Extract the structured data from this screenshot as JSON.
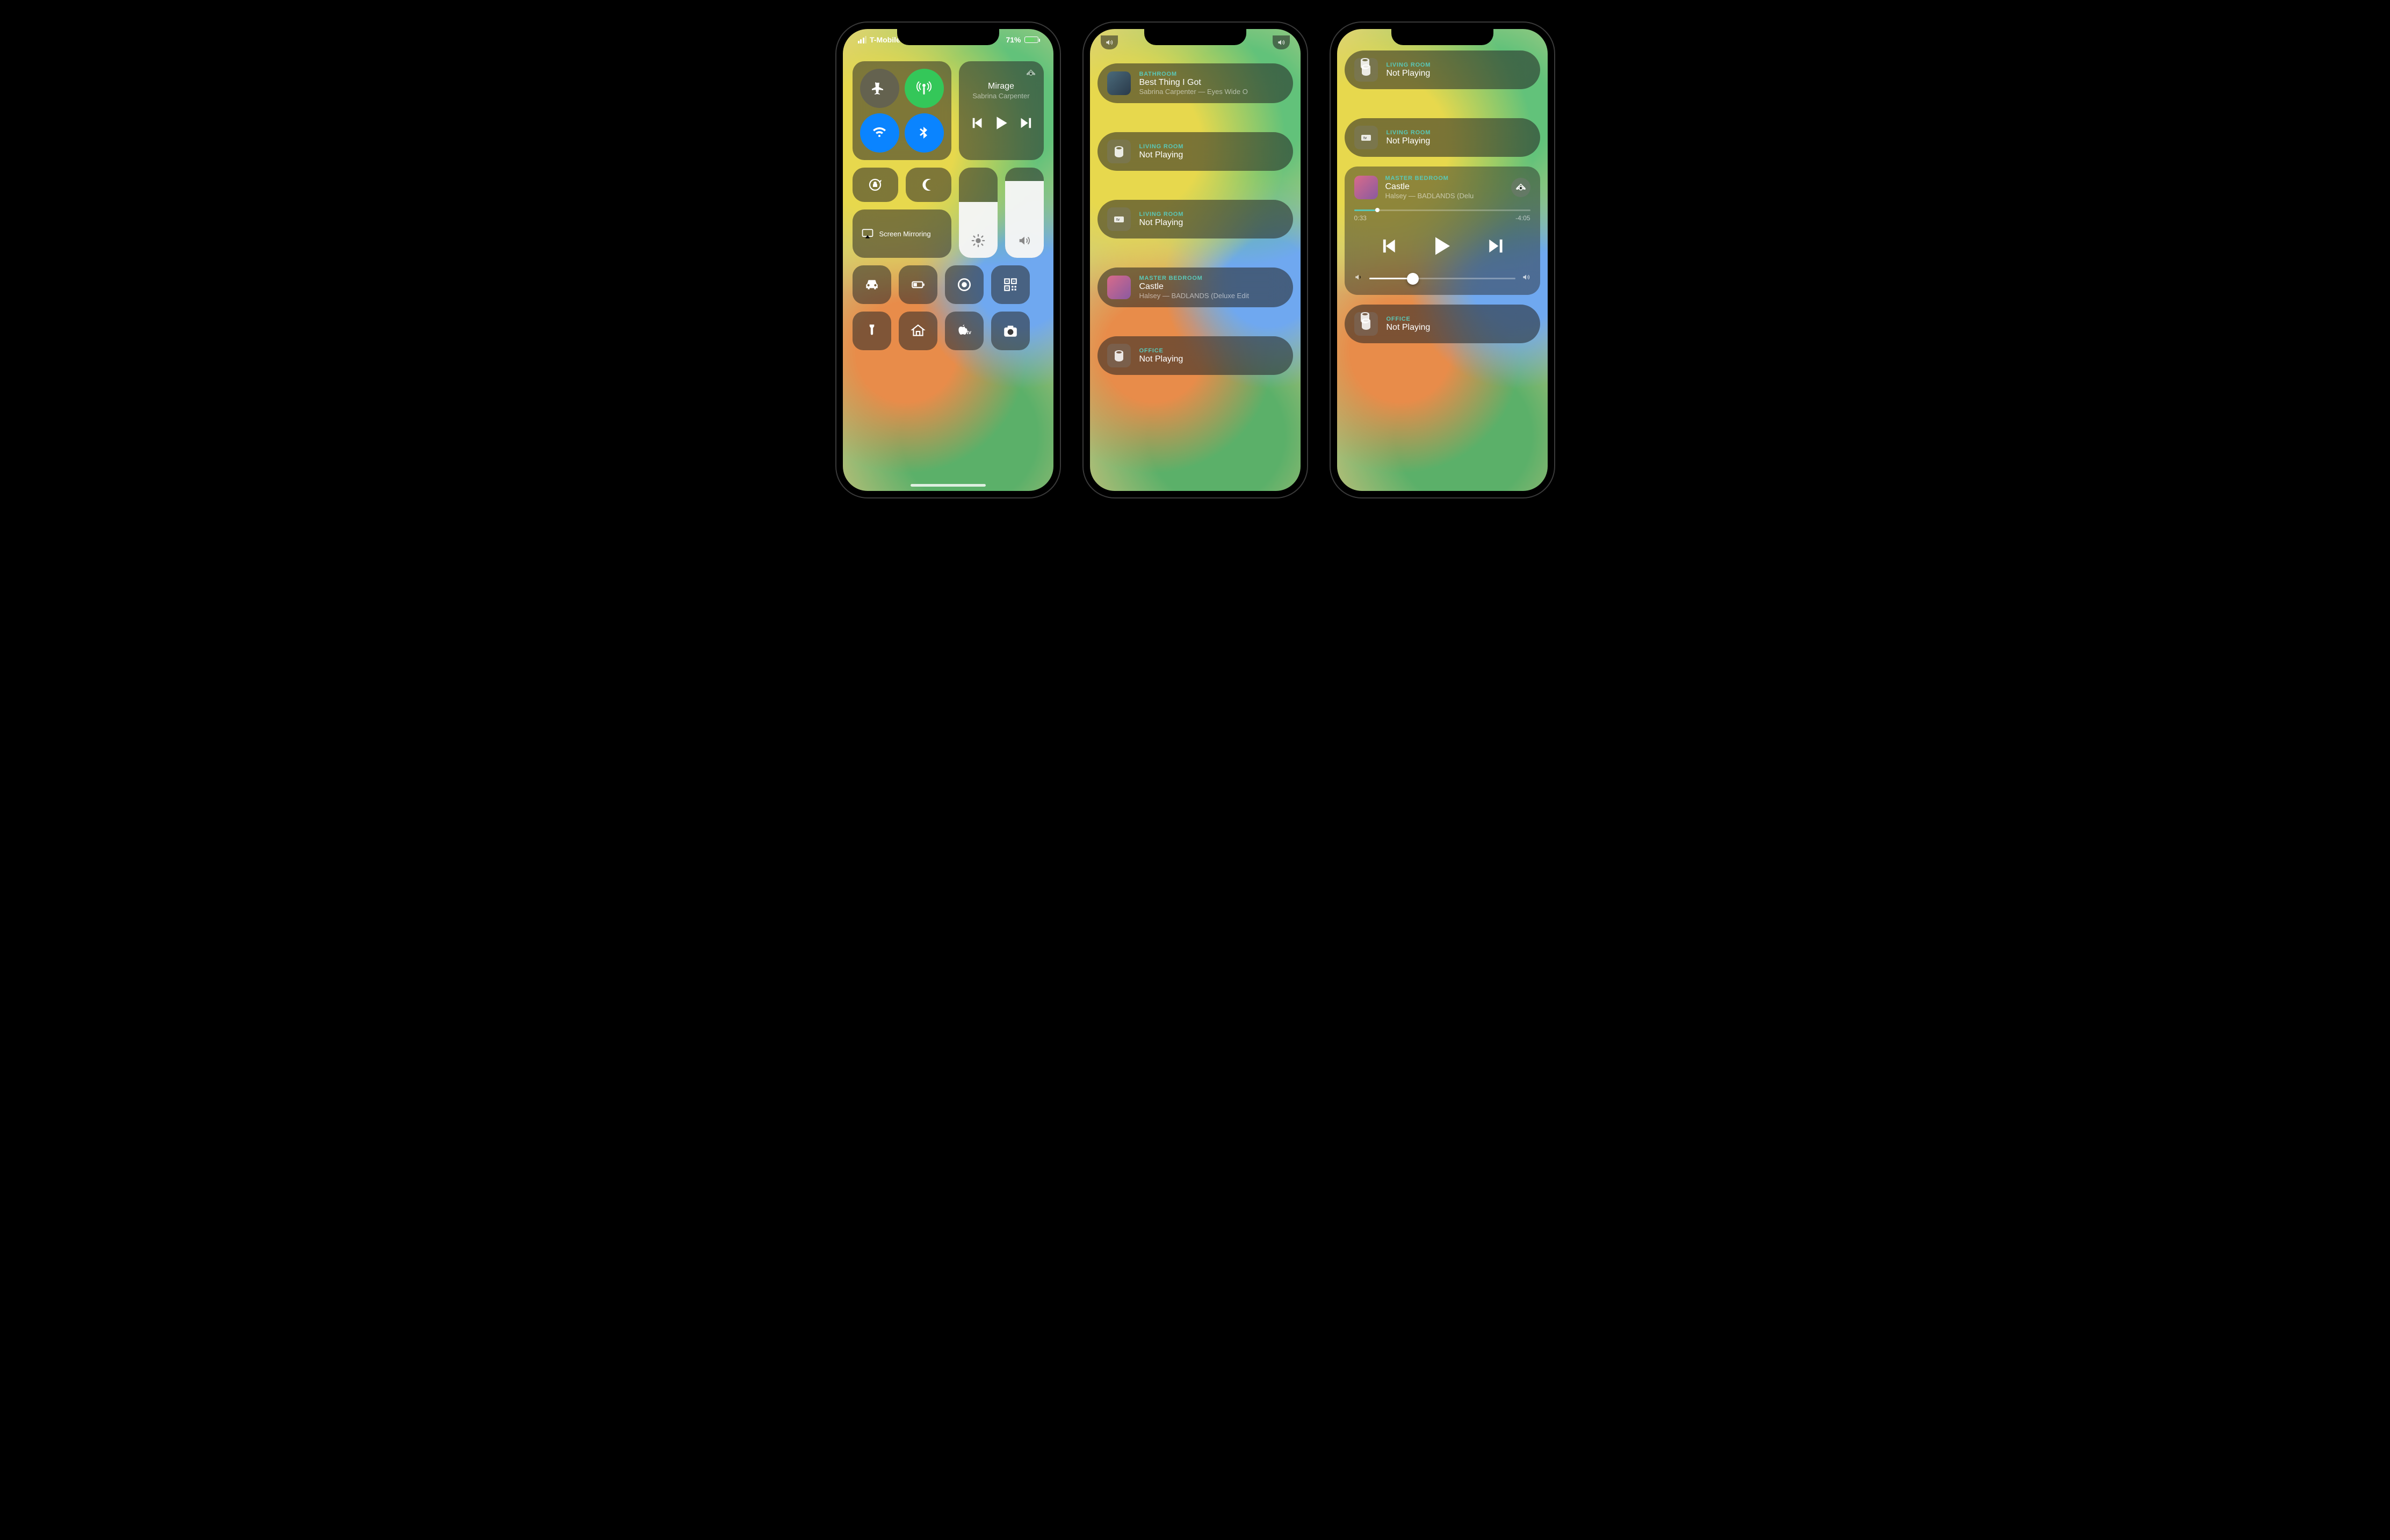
{
  "status": {
    "carrier": "T-Mobile Wi-Fi",
    "battery_pct": "71%"
  },
  "cc": {
    "music": {
      "title": "Mirage",
      "artist": "Sabrina Carpenter"
    },
    "mirror": "Screen Mirroring",
    "brightness_pct": 62,
    "volume_pct": 85
  },
  "screen2": [
    {
      "loc": "BATHROOM",
      "title": "Best Thing I Got",
      "sub": "Sabrina Carpenter — Eyes Wide O",
      "icon": "homepod",
      "active": true,
      "art": "art2"
    },
    {
      "loc": "LIVING ROOM",
      "title": "Not Playing",
      "sub": "",
      "icon": "homepod",
      "active": false
    },
    {
      "loc": "LIVING ROOM",
      "title": "Not Playing",
      "sub": "",
      "icon": "appletv",
      "active": false
    },
    {
      "loc": "MASTER BEDROOM",
      "title": "Castle",
      "sub": "Halsey — BADLANDS (Deluxe Edit",
      "icon": "art",
      "active": true,
      "art": "art"
    },
    {
      "loc": "OFFICE",
      "title": "Not Playing",
      "sub": "",
      "icon": "homepod",
      "active": false
    }
  ],
  "screen3_top": [
    {
      "loc": "LIVING ROOM",
      "title": "Not Playing",
      "icon": "homepod-double"
    },
    {
      "loc": "LIVING ROOM",
      "title": "Not Playing",
      "icon": "appletv"
    }
  ],
  "player": {
    "loc": "MASTER BEDROOM",
    "title": "Castle",
    "sub": "Halsey — BADLANDS (Delu",
    "elapsed": "0:33",
    "remaining": "-4:05",
    "progress_pct": 12,
    "volume_pct": 30
  },
  "screen3_bottom": [
    {
      "loc": "OFFICE",
      "title": "Not Playing",
      "icon": "homepod-double"
    }
  ]
}
